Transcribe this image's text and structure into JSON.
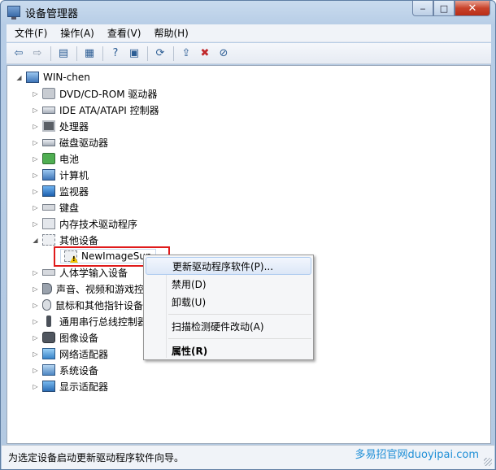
{
  "window": {
    "title": "设备管理器",
    "caption": {
      "min": "‒",
      "max": "□",
      "close": "✕"
    }
  },
  "menubar": [
    "文件(F)",
    "操作(A)",
    "查看(V)",
    "帮助(H)"
  ],
  "toolbar": [
    {
      "icon": "back-arrow-icon",
      "glyph": "⇦"
    },
    {
      "icon": "forward-arrow-icon",
      "glyph": "⇨"
    },
    {
      "icon": "show-hide-tree-icon",
      "glyph": "▤"
    },
    {
      "icon": "properties-icon",
      "glyph": "▦"
    },
    {
      "icon": "help-icon",
      "glyph": "?"
    },
    {
      "icon": "view-icon",
      "glyph": "▣"
    },
    {
      "icon": "scan-hardware-icon",
      "glyph": "⟳"
    },
    {
      "icon": "update-driver-icon",
      "glyph": "⇪"
    },
    {
      "icon": "uninstall-icon",
      "glyph": "✖"
    },
    {
      "icon": "disable-icon",
      "glyph": "⊘"
    }
  ],
  "tree": {
    "root": "WIN-chen",
    "categories": [
      {
        "label": "DVD/CD-ROM 驱动器",
        "icon": "disc"
      },
      {
        "label": "IDE ATA/ATAPI 控制器",
        "icon": "drive"
      },
      {
        "label": "处理器",
        "icon": "chip"
      },
      {
        "label": "磁盘驱动器",
        "icon": "drive"
      },
      {
        "label": "电池",
        "icon": "battery"
      },
      {
        "label": "计算机",
        "icon": "computer"
      },
      {
        "label": "监视器",
        "icon": "monitor"
      },
      {
        "label": "键盘",
        "icon": "keyboard"
      },
      {
        "label": "内存技术驱动程序",
        "icon": "memory"
      },
      {
        "label": "其他设备",
        "icon": "unknown"
      },
      {
        "label": "人体学输入设备",
        "icon": "keyboard"
      },
      {
        "label": "声音、视频和游戏控",
        "icon": "speaker"
      },
      {
        "label": "鼠标和其他指针设备",
        "icon": "mouse"
      },
      {
        "label": "通用串行总线控制器",
        "icon": "usb"
      },
      {
        "label": "图像设备",
        "icon": "camera"
      },
      {
        "label": "网络适配器",
        "icon": "network"
      },
      {
        "label": "系统设备",
        "icon": "system"
      },
      {
        "label": "显示适配器",
        "icon": "display"
      }
    ],
    "selected_child": "NewImageSup"
  },
  "context_menu": {
    "items": [
      "更新驱动程序软件(P)...",
      "禁用(D)",
      "卸载(U)",
      "扫描检测硬件改动(A)",
      "属性(R)"
    ]
  },
  "status": {
    "text": "为选定设备启动更新驱动程序软件向导。"
  },
  "watermark": "多易招官网duoyipai.com"
}
